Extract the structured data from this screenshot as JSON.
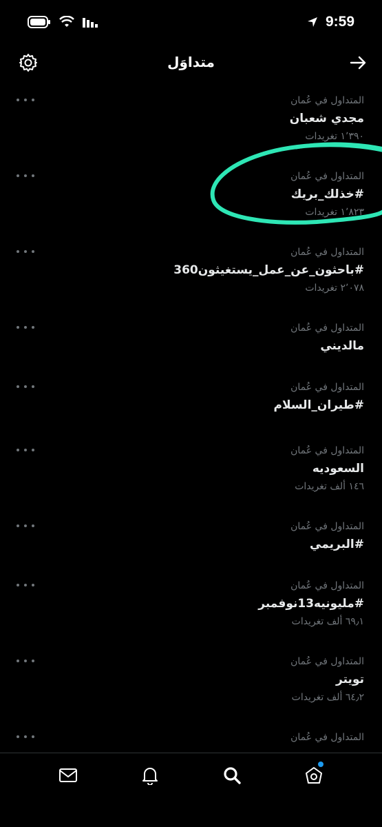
{
  "status": {
    "time": "9:59"
  },
  "nav": {
    "title": "متداوَل"
  },
  "trends": [
    {
      "context": "المتداول في عُمان",
      "name": "مجدي شعبان",
      "count": "١٬٣٩٠ تغريدات"
    },
    {
      "context": "المتداول في عُمان",
      "name": "#خذلك_بريك",
      "count": "١٬٨٢٣ تغريدات"
    },
    {
      "context": "المتداول في عُمان",
      "name": "#باحثون_عن_عمل_يستغيثون360",
      "count": "٢٬٠٧٨ تغريدات"
    },
    {
      "context": "المتداول في عُمان",
      "name": "مالديني",
      "count": ""
    },
    {
      "context": "المتداول في عُمان",
      "name": "#طيران_السلام",
      "count": ""
    },
    {
      "context": "المتداول في عُمان",
      "name": "السعوديه",
      "count": "١٤٦ ألف تغريدات"
    },
    {
      "context": "المتداول في عُمان",
      "name": "#البريمي",
      "count": ""
    },
    {
      "context": "المتداول في عُمان",
      "name": "#مليونيه13نوفمبر",
      "count": "٦٩٫١ ألف تغريدات"
    },
    {
      "context": "المتداول في عُمان",
      "name": "تويتر",
      "count": "٦٤٫٢ ألف تغريدات"
    },
    {
      "context": "المتداول في عُمان",
      "name": "",
      "count": ""
    }
  ],
  "colors": {
    "annotation": "#2ee6b5",
    "notification_dot": "#1d9bf0"
  }
}
